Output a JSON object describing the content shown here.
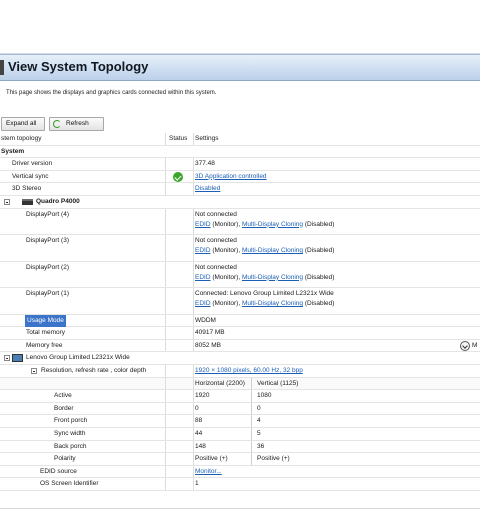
{
  "banner": {
    "title": "View System Topology"
  },
  "description": "This page shows the displays and graphics cards connected within this system.",
  "toolbar": {
    "expand_label": "Expand all",
    "refresh_label": "Refresh"
  },
  "columns": {
    "topology": "stem topology",
    "status": "Status",
    "settings": "Settings"
  },
  "system_label": "System",
  "rows": {
    "driver_version": {
      "label": "Driver version",
      "value": "377.48"
    },
    "vertical_sync": {
      "label": "Vertical sync",
      "value": "3D Application controlled"
    },
    "stereo_3d": {
      "label": "3D Stereo",
      "value": "Disabled"
    },
    "gpu": {
      "label": "Quadro P4000"
    },
    "dp4": {
      "label": "DisplayPort (4)",
      "line1": "Not connected",
      "edid": "EDID",
      "monitor": " (Monitor), ",
      "mdc": "Multi-Display Cloning",
      "disabled": " (Disabled)"
    },
    "dp3": {
      "label": "DisplayPort (3)",
      "line1": "Not connected",
      "edid": "EDID",
      "monitor": " (Monitor), ",
      "mdc": "Multi-Display Cloning",
      "disabled": " (Disabled)"
    },
    "dp2": {
      "label": "DisplayPort (2)",
      "line1": "Not connected",
      "edid": "EDID",
      "monitor": " (Monitor), ",
      "mdc": "Multi-Display Cloning",
      "disabled": " (Disabled)"
    },
    "dp1": {
      "label": "DisplayPort (1)",
      "line1": "Connected: Lenovo Group Limited L2321x Wide",
      "edid": "EDID",
      "monitor": " (Monitor), ",
      "mdc": "Multi-Display Cloning",
      "disabled": " (Disabled)"
    },
    "usage_mode": {
      "label": "Usage Mode",
      "value": "WDDM"
    },
    "total_memory": {
      "label": "Total memory",
      "value": "40917 MB"
    },
    "memory_free": {
      "label": "Memory free",
      "value": "8052 MB",
      "extra": "M"
    },
    "monitor": {
      "label": "Lenovo Group Limited L2321x Wide"
    },
    "resolution": {
      "label": "Resolution, refresh rate , color depth",
      "value": "1920 × 1080 pixels, 60.00 Hz, 32 bpp"
    },
    "timing_header": {
      "horizontal": "Horizontal (2200)",
      "vertical": "Vertical (1125)"
    },
    "timing": [
      {
        "label": "Active",
        "h": "1920",
        "v": "1080"
      },
      {
        "label": "Border",
        "h": "0",
        "v": "0"
      },
      {
        "label": "Front porch",
        "h": "88",
        "v": "4"
      },
      {
        "label": "Sync width",
        "h": "44",
        "v": "5"
      },
      {
        "label": "Back porch",
        "h": "148",
        "v": "36"
      },
      {
        "label": "Polarity",
        "h": "Positive (+)",
        "v": "Positive (+)"
      }
    ],
    "edid_source": {
      "label": "EDID source",
      "value": "Monitor..."
    },
    "os_id": {
      "label": "OS Screen Identifier",
      "value": "1"
    }
  },
  "colors": {
    "link": "#1a5fb4",
    "selection": "#3b74c9",
    "ok": "#3aa62a"
  },
  "icons": [
    "refresh-icon",
    "check-icon",
    "gpu-icon",
    "monitor-icon",
    "expander-icon",
    "dropdown-icon"
  ]
}
